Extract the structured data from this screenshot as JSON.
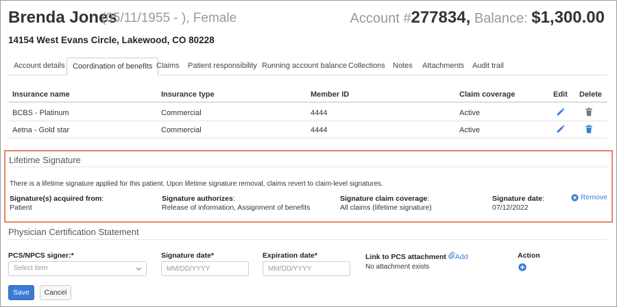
{
  "patient": {
    "name": "Brenda Jones",
    "meta": "(05/11/1955 - ), Female",
    "address": "14154 West Evans Circle, Lakewood, CO 80228"
  },
  "account": {
    "prefix": "Account #",
    "number": "277834,",
    "balance_label": "Balance:",
    "balance_value": "$1,300.00"
  },
  "tabs": [
    {
      "label": "Account details",
      "active": false
    },
    {
      "label": "Coordination of benefits",
      "active": true
    },
    {
      "label": "Claims",
      "active": false
    },
    {
      "label": "Patient responsibility",
      "active": false
    },
    {
      "label": "Running account balance",
      "active": false
    },
    {
      "label": "Collections",
      "active": false
    },
    {
      "label": "Notes",
      "active": false
    },
    {
      "label": "Attachments",
      "active": false
    },
    {
      "label": "Audit trail",
      "active": false
    }
  ],
  "insurance": {
    "columns": {
      "name": "Insurance name",
      "type": "Insurance type",
      "member_id": "Member ID",
      "coverage": "Claim coverage",
      "edit": "Edit",
      "delete": "Delete"
    },
    "rows": [
      {
        "name": "BCBS - Platinum",
        "type": "Commercial",
        "member_id": "4444",
        "coverage": "Active",
        "edit_icon": "pencil-icon",
        "delete_icon": "trash-icon",
        "delete_color": "#777777"
      },
      {
        "name": "Aetna - Gold star",
        "type": "Commercial",
        "member_id": "4444",
        "coverage": "Active",
        "edit_icon": "pencil-icon",
        "delete_icon": "trash-icon",
        "delete_color": "#3a7bd5"
      }
    ]
  },
  "lifetime_signature": {
    "title": "Lifetime Signature",
    "description": "There is a lifetime signature applied for this patient. Upon lifetime signature removal, claims revert to claim-level signatures.",
    "acquired_label": "Signature(s) acquired from",
    "acquired_value": "Patient",
    "authorizes_label": "Signature authorizes",
    "authorizes_value": "Release of information, Assignment of benefits",
    "coverage_label": "Signature claim coverage",
    "coverage_value": "All claims (lifetime signature)",
    "date_label": "Signature date",
    "date_value": "07/12/2022",
    "remove_label": "Remove",
    "highlight_color": "#e8835f"
  },
  "pcs": {
    "title": "Physician Certification Statement",
    "signer_label": "PCS/NPCS signer:*",
    "signer_placeholder": "Select item",
    "sig_date_label": "Signature date*",
    "sig_date_placeholder": "MM/DD/YYYY",
    "exp_date_label": "Expiration date*",
    "exp_date_placeholder": "MM/DD/YYYY",
    "link_label": "Link to PCS attachment",
    "add_label": "Add",
    "no_attachment": "No attachment exists",
    "action_label": "Action"
  },
  "buttons": {
    "save": "Save",
    "cancel": "Cancel"
  },
  "colors": {
    "accent": "#3a7bd5",
    "text": "#333333",
    "muted": "#999999"
  }
}
